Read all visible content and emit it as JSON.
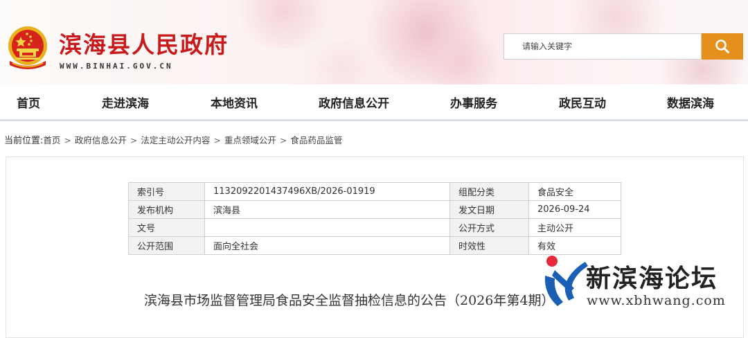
{
  "header": {
    "site_title": "滨海县人民政府",
    "site_url": "WWW.BINHAI.GOV.CN",
    "search": {
      "placeholder": "请输入关键字"
    }
  },
  "nav": {
    "items": [
      "首页",
      "走进滨海",
      "本地资讯",
      "政府信息公开",
      "办事服务",
      "政民互动",
      "数据滨海"
    ]
  },
  "breadcrumb": {
    "label": "当前位置:",
    "items": [
      "首页",
      "政府信息公开",
      "法定主动公开内容",
      "重点领域公开",
      "食品药品监管"
    ],
    "separator": ">"
  },
  "meta_table": {
    "rows": [
      {
        "k1": "索引号",
        "v1": "1132092201437496XB/2026-01919",
        "k2": "组配分类",
        "v2": "食品安全"
      },
      {
        "k1": "发布机构",
        "v1": "滨海县",
        "k2": "发文日期",
        "v2": "2026-09-24"
      },
      {
        "k1": "文号",
        "v1": "",
        "k2": "公开方式",
        "v2": "主动公开"
      },
      {
        "k1": "公开范围",
        "v1": "面向全社会",
        "k2": "时效性",
        "v2": "有效"
      }
    ]
  },
  "document": {
    "title": "滨海县市场监督管理局食品安全监督抽检信息的公告（2026年第4期）"
  },
  "watermark": {
    "name": "新滨海论坛",
    "url": "www.xbhwang.com"
  },
  "colors": {
    "title_red": "#c81a1a",
    "search_orange": "#e5901c",
    "nav_border": "#d9dfeb",
    "table_key_bg": "#f2f2f2",
    "watermark_blue": "#1a5fb4",
    "watermark_red": "#e5293a"
  },
  "icons": {
    "emblem": "national-emblem-icon",
    "search": "search-icon",
    "watermark_logo": "xbh-logo-icon"
  }
}
